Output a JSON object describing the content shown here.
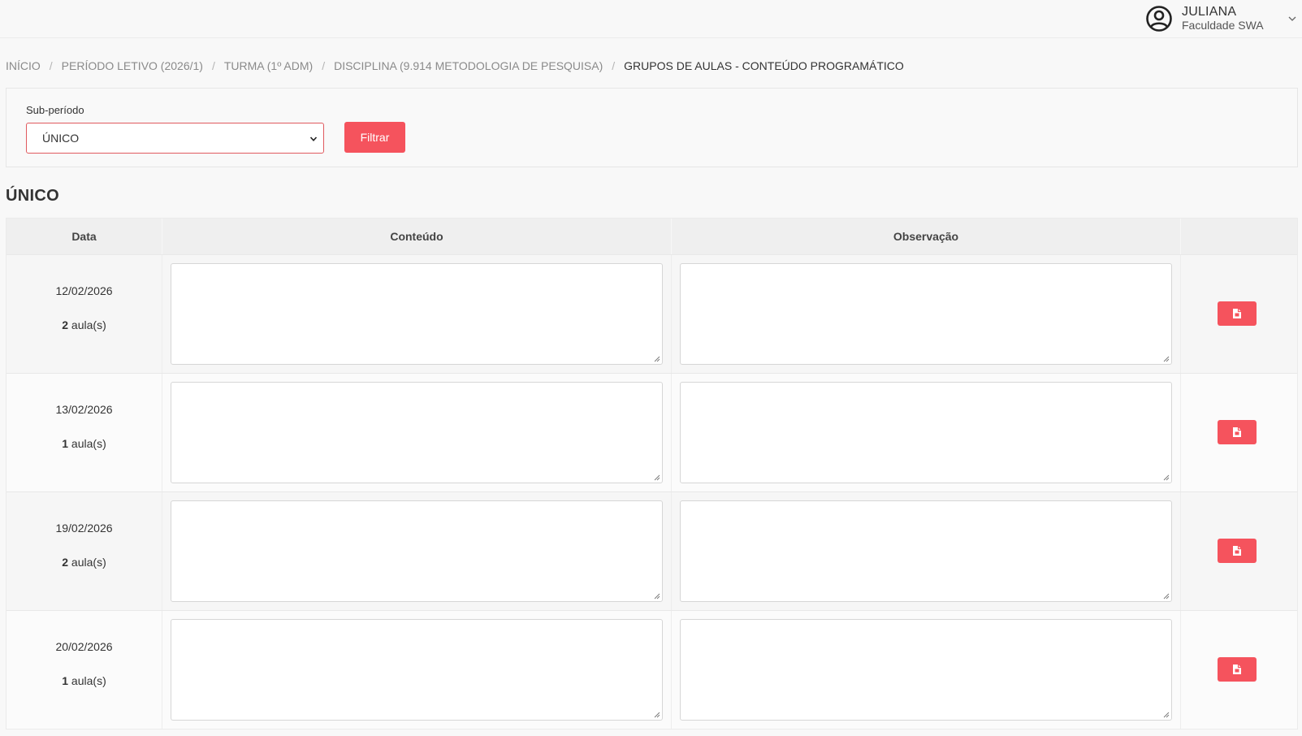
{
  "user": {
    "name": "JULIANA",
    "organization": "Faculdade SWA",
    "icon": "account-circle-icon"
  },
  "breadcrumb": [
    {
      "label": "INÍCIO"
    },
    {
      "label": "PERÍODO LETIVO (2026/1)"
    },
    {
      "label": "TURMA (1º ADM)"
    },
    {
      "label": "DISCIPLINA (9.914 METODOLOGIA DE PESQUISA)"
    },
    {
      "label": "GRUPOS DE AULAS - CONTEÚDO PROGRAMÁTICO"
    }
  ],
  "filter": {
    "label": "Sub-período",
    "selected": "ÚNICO",
    "button_label": "Filtrar"
  },
  "section": {
    "title": "ÚNICO"
  },
  "table": {
    "headers": {
      "date": "Data",
      "content": "Conteúdo",
      "observation": "Observação"
    },
    "rows": [
      {
        "date": "12/02/2026",
        "count": "2",
        "unit": " aula(s)",
        "content": "",
        "observation": ""
      },
      {
        "date": "13/02/2026",
        "count": "1",
        "unit": " aula(s)",
        "content": "",
        "observation": ""
      },
      {
        "date": "19/02/2026",
        "count": "2",
        "unit": " aula(s)",
        "content": "",
        "observation": ""
      },
      {
        "date": "20/02/2026",
        "count": "1",
        "unit": " aula(s)",
        "content": "",
        "observation": ""
      }
    ]
  },
  "colors": {
    "accent": "#f5535d",
    "select_border": "#e05a5f",
    "background": "#f8f8f8"
  }
}
